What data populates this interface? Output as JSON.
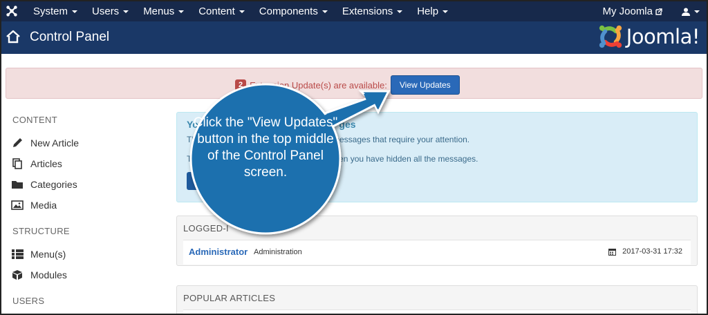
{
  "navbar": {
    "menu": [
      "System",
      "Users",
      "Menus",
      "Content",
      "Components",
      "Extensions",
      "Help"
    ],
    "my_joomla": "My Joomla"
  },
  "header": {
    "title": "Control Panel",
    "brand": "Joomla!"
  },
  "alert": {
    "count": "2",
    "text": "Extension Update(s) are available:",
    "button": "View Updates"
  },
  "sidebar": {
    "sections": [
      {
        "heading": "CONTENT",
        "items": [
          "New Article",
          "Articles",
          "Categories",
          "Media"
        ]
      },
      {
        "heading": "STRUCTURE",
        "items": [
          "Menu(s)",
          "Modules"
        ]
      },
      {
        "heading": "USERS",
        "items": []
      }
    ]
  },
  "messages": {
    "title": "You",
    "title_end": "ges",
    "line1_start": "Th",
    "line1_end": "messages that require your attention.",
    "line2_start": "Th",
    "line2_end": "en you have hidden all the messages."
  },
  "logged_in": {
    "title": "LOGGED-I",
    "name": "Administrator",
    "role": "Administration",
    "date": "2017-03-31 17:32"
  },
  "popular": {
    "title": "POPULAR ARTICLES"
  },
  "callout": {
    "text": "Click the \"View Updates\" button in the top middle of the Control Panel screen."
  },
  "colors": {
    "navbar": "#17294b",
    "header": "#1a3867",
    "alert_bg": "#f2dede",
    "primary": "#2a69b8",
    "callout": "#1e6fae"
  }
}
